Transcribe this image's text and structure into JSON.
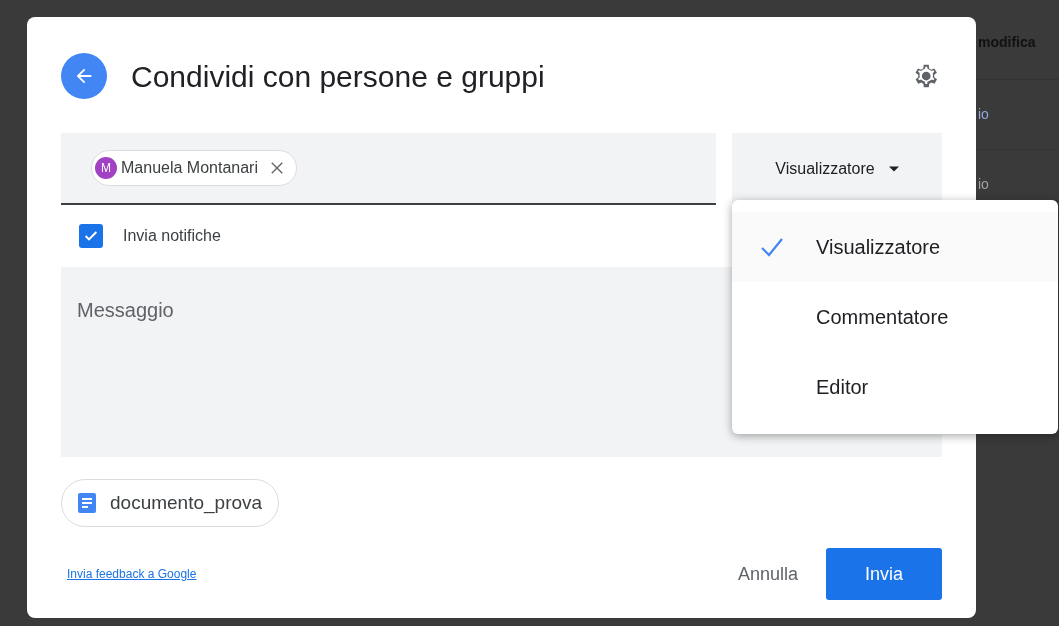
{
  "background": {
    "header": "modifica",
    "rows": [
      "io",
      "io"
    ]
  },
  "dialog": {
    "title": "Condividi con persone e gruppi",
    "recipients": [
      {
        "initial": "M",
        "name": "Manuela Montanari",
        "color": "#a142c4"
      }
    ],
    "role": "Visualizzatore",
    "notify": {
      "label": "Invia notifiche",
      "checked": true
    },
    "message": {
      "placeholder": "Messaggio"
    },
    "document": "documento_prova",
    "feedback_link": "Invia feedback a Google",
    "cancel": "Annulla",
    "send": "Invia"
  },
  "role_menu": [
    {
      "label": "Visualizzatore",
      "selected": true
    },
    {
      "label": "Commentatore",
      "selected": false
    },
    {
      "label": "Editor",
      "selected": false
    }
  ]
}
